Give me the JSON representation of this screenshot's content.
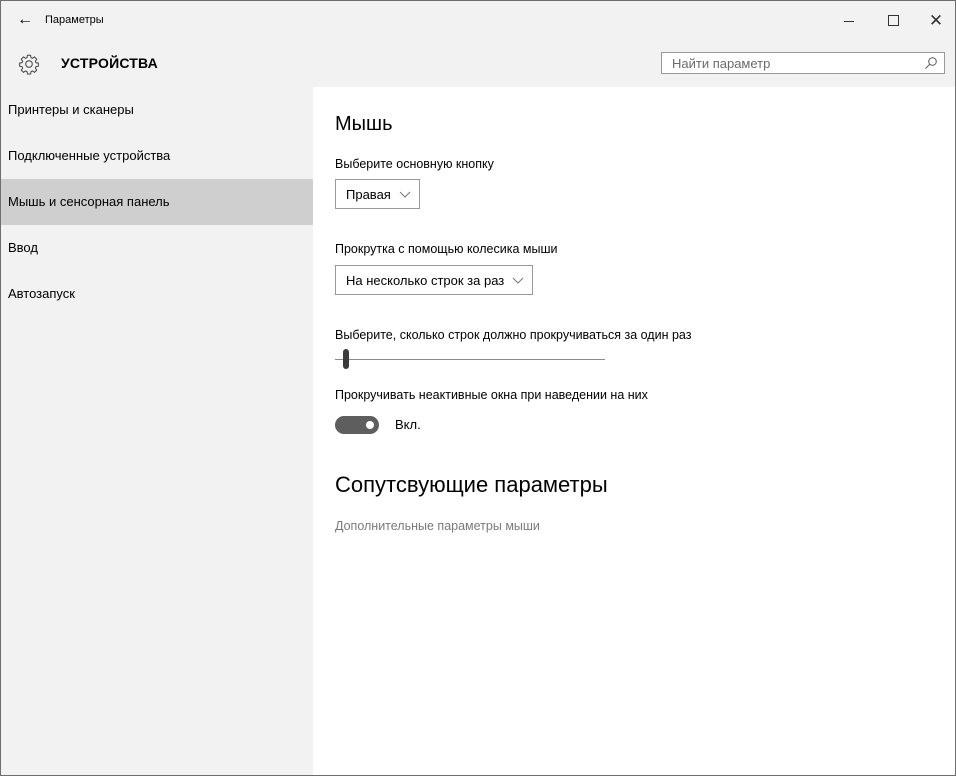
{
  "window": {
    "title": "Параметры",
    "controls": {
      "minimize": "minimize",
      "maximize": "maximize",
      "close": "✕"
    }
  },
  "header": {
    "section_title": "УСТРОЙСТВА",
    "search_placeholder": "Найти параметр"
  },
  "sidebar": {
    "items": [
      {
        "label": "Принтеры и сканеры"
      },
      {
        "label": "Подключенные устройства"
      },
      {
        "label": "Мышь и сенсорная панель",
        "active": true
      },
      {
        "label": "Ввод"
      },
      {
        "label": "Автозапуск"
      }
    ]
  },
  "main": {
    "title": "Мышь",
    "primary_button": {
      "label": "Выберите основную кнопку",
      "value": "Правая"
    },
    "wheel_scroll": {
      "label": "Прокрутка с помощью колесика мыши",
      "value": "На несколько строк за раз"
    },
    "lines_to_scroll": {
      "label": "Выберите, сколько строк должно прокручиваться за один раз",
      "level_fraction": 0.03
    },
    "inactive_scroll": {
      "label": "Прокручивать неактивные окна при наведении на них",
      "state": "Вкл.",
      "on": true
    },
    "related": {
      "title": "Сопутсвующие параметры",
      "link": "Дополнительные параметры мыши"
    }
  },
  "colors": {
    "sidebar_bg": "#f2f2f2",
    "active_item": "#cfcfcf",
    "toggle_on": "#5e5e5e",
    "link": "#7a7a7a"
  }
}
